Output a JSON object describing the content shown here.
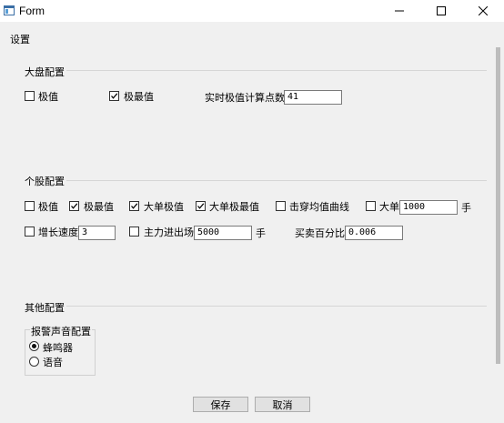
{
  "window": {
    "title": "Form"
  },
  "page_header": "设置",
  "section_market": {
    "title": "大盘配置",
    "extreme": {
      "label": "极值",
      "checked": false
    },
    "max_extreme": {
      "label": "极最值",
      "checked": true
    },
    "realtime_points": {
      "label": "实时极值计算点数",
      "value": "41"
    }
  },
  "section_stock": {
    "title": "个股配置",
    "extreme": {
      "label": "极值",
      "checked": false
    },
    "max_extreme": {
      "label": "极最值",
      "checked": true
    },
    "big_order_extreme": {
      "label": "大单极值",
      "checked": true
    },
    "big_order_max_extreme": {
      "label": "大单极最值",
      "checked": true
    },
    "cross_avg_line": {
      "label": "击穿均值曲线",
      "checked": false
    },
    "big_order": {
      "label": "大单",
      "checked": false,
      "value": "1000",
      "unit": "手"
    },
    "growth_speed": {
      "label": "增长速度",
      "checked": false,
      "value": "3"
    },
    "main_in_out": {
      "label": "主力进出场",
      "checked": false,
      "value": "5000",
      "unit": "手"
    },
    "buy_sell_pct": {
      "label": "买卖百分比",
      "value": "0.006"
    }
  },
  "section_other": {
    "title": "其他配置",
    "alarm_group": {
      "title": "报警声音配置",
      "options": [
        {
          "label": "蜂鸣器",
          "selected": true
        },
        {
          "label": "语音",
          "selected": false
        }
      ]
    }
  },
  "buttons": {
    "save": "保存",
    "cancel": "取消"
  }
}
